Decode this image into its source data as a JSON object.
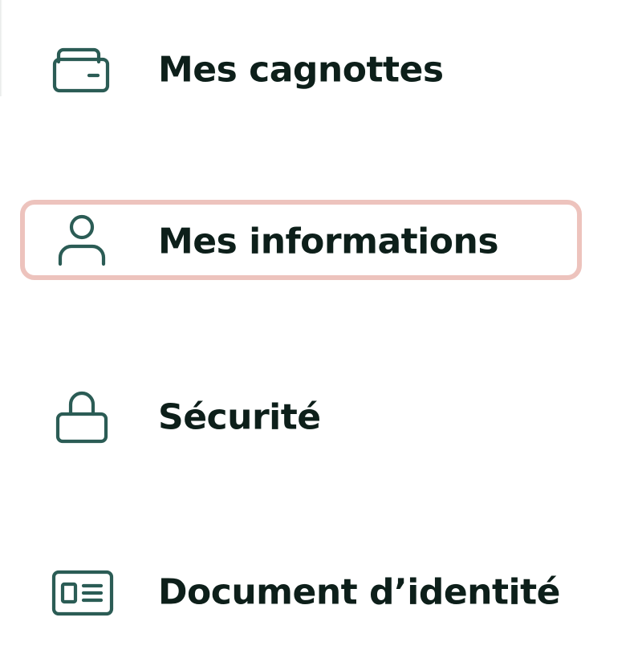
{
  "colors": {
    "icon": "#2b5c55",
    "text": "#0d1f1a",
    "selection_border": "#edc3bd",
    "background": "#ffffff"
  },
  "menu": {
    "items": [
      {
        "label": "Mes cagnottes",
        "icon": "wallet-icon",
        "selected": false
      },
      {
        "label": "Mes informations",
        "icon": "user-icon",
        "selected": true
      },
      {
        "label": "Sécurité",
        "icon": "lock-icon",
        "selected": false
      },
      {
        "label": "Document d’identité",
        "icon": "id-card-icon",
        "selected": false
      }
    ]
  }
}
